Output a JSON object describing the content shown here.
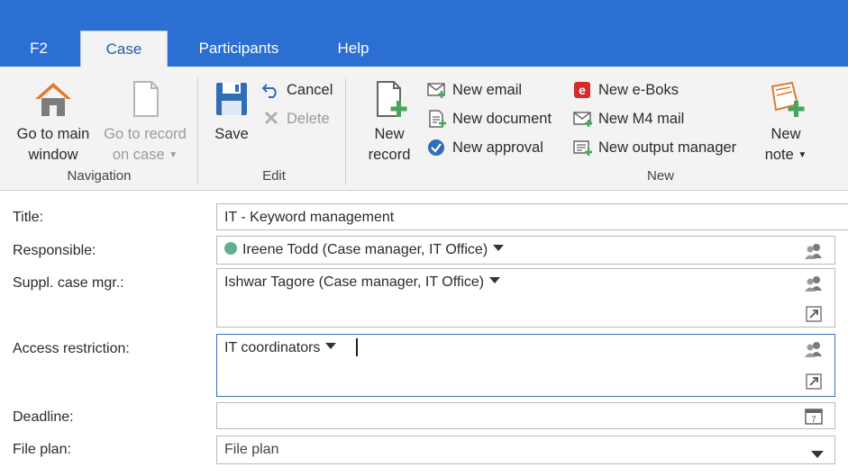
{
  "tabs": {
    "f2": "F2",
    "case": "Case",
    "participants": "Participants",
    "help": "Help"
  },
  "ribbon": {
    "navigation": {
      "group_label": "Navigation",
      "go_main_line1": "Go to main",
      "go_main_line2": "window",
      "go_record_line1": "Go to record",
      "go_record_line2": "on case"
    },
    "edit": {
      "group_label": "Edit",
      "save": "Save",
      "cancel": "Cancel",
      "delete": "Delete"
    },
    "new": {
      "group_label": "New",
      "new_record_line1": "New",
      "new_record_line2": "record",
      "new_email": "New email",
      "new_document": "New document",
      "new_approval": "New approval",
      "new_eboks": "New e-Boks",
      "new_m4mail": "New M4 mail",
      "new_output_manager": "New output manager",
      "new_note_line1": "New",
      "new_note_line2": "note"
    }
  },
  "form": {
    "title_label": "Title:",
    "title_value": "IT - Keyword management",
    "responsible_label": "Responsible:",
    "responsible_value": "Ireene Todd (Case manager, IT Office)",
    "suppl_label": "Suppl. case mgr.:",
    "suppl_value": "Ishwar Tagore (Case manager, IT Office)",
    "access_label": "Access restriction:",
    "access_value": "IT coordinators",
    "deadline_label": "Deadline:",
    "deadline_value": "",
    "fileplan_label": "File plan:",
    "fileplan_value": "File plan"
  },
  "colors": {
    "tabbar": "#2a6fd1",
    "ribbon": "#f3f3f3",
    "status_dot": "#5fb08c",
    "focus_border": "#3a6fb7"
  },
  "icons": {
    "go_main": "house-icon",
    "go_record": "document-outline-icon",
    "save": "floppy-disk-icon",
    "cancel": "undo-arrow-icon",
    "delete": "x-delete-icon",
    "new_record": "document-plus-icon",
    "new_email": "envelope-plus-icon",
    "new_document": "document-lines-plus-icon",
    "new_approval": "checkmark-circle-icon",
    "new_eboks": "eboks-icon",
    "new_m4mail": "envelope-m4-icon",
    "new_output_manager": "output-manager-icon",
    "new_note": "note-plus-icon",
    "participants": "people-icon",
    "expand": "expand-arrow-icon",
    "calendar": "calendar-icon"
  }
}
